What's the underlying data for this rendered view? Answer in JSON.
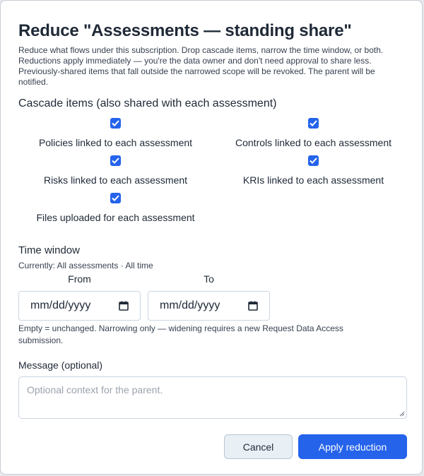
{
  "dialog": {
    "title": "Reduce \"Assessments — standing share\"",
    "description": "Reduce what flows under this subscription. Drop cascade items, narrow the time window, or both. Reductions apply immediately — you're the data owner and don't need approval to share less. Previously-shared items that fall outside the narrowed scope will be revoked. The parent will be notified."
  },
  "cascade": {
    "label": "Cascade items (also shared with each assessment)",
    "items": [
      {
        "label": "Policies linked to each assessment",
        "checked": true
      },
      {
        "label": "Controls linked to each assessment",
        "checked": true
      },
      {
        "label": "Risks linked to each assessment",
        "checked": true
      },
      {
        "label": "KRIs linked to each assessment",
        "checked": true
      },
      {
        "label": "Files uploaded for each assessment",
        "checked": true
      }
    ]
  },
  "time_window": {
    "label": "Time window",
    "current": "Currently: All assessments · All time",
    "from_label": "From",
    "to_label": "To",
    "from_value": "mm/dd/yyyy",
    "to_value": "mm/dd/yyyy",
    "hint": "Empty = unchanged. Narrowing only — widening requires a new Request Data Access submission."
  },
  "message": {
    "label": "Message (optional)",
    "placeholder": "Optional context for the parent."
  },
  "actions": {
    "cancel_label": "Cancel",
    "apply_label": "Apply reduction"
  },
  "colors": {
    "accent": "#2563eb",
    "cancel_bg": "#e8eff5"
  }
}
